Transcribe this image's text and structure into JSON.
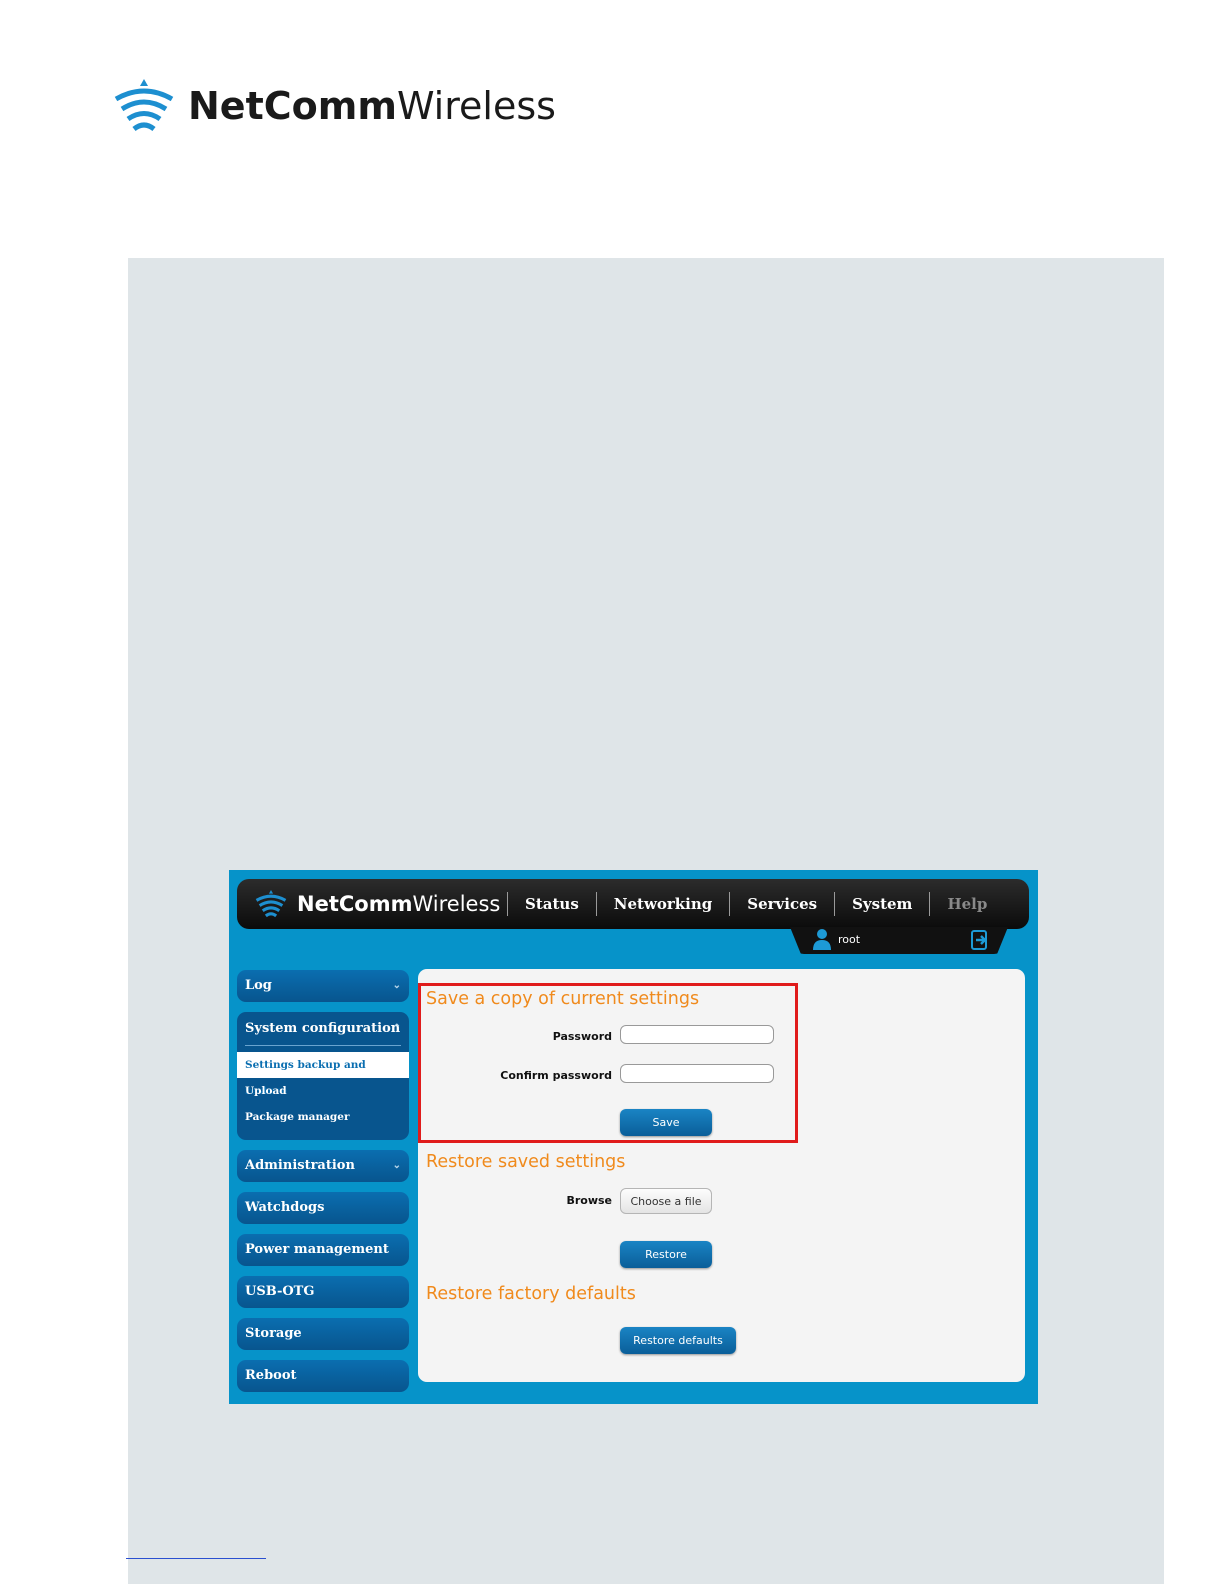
{
  "document": {
    "logo": {
      "brand_bold": "NetComm",
      "brand_light": "Wireless"
    }
  },
  "router_ui": {
    "logo": {
      "brand_bold": "NetComm",
      "brand_light": "Wireless"
    },
    "nav": {
      "status": "Status",
      "networking": "Networking",
      "services": "Services",
      "system": "System",
      "help": "Help"
    },
    "user": {
      "name": "root"
    },
    "sidebar": {
      "log": "Log",
      "system_configuration": "System configuration",
      "sub_items": {
        "settings_backup": "Settings backup and restore",
        "upload": "Upload",
        "package_manager": "Package manager"
      },
      "administration": "Administration",
      "watchdogs": "Watchdogs",
      "power_management": "Power management",
      "usb_otg": "USB-OTG",
      "storage": "Storage",
      "reboot": "Reboot"
    },
    "content": {
      "save_section": {
        "title": "Save a copy of current settings",
        "password_label": "Password",
        "confirm_label": "Confirm password",
        "password_value": "",
        "confirm_value": "",
        "save_button": "Save"
      },
      "restore_section": {
        "title": "Restore saved settings",
        "browse_label": "Browse",
        "choose_file_button": "Choose a file",
        "restore_button": "Restore"
      },
      "factory_section": {
        "title": "Restore factory defaults",
        "restore_defaults_button": "Restore defaults"
      }
    },
    "colors": {
      "frame_blue": "#0693c9",
      "section_title_orange": "#f08a1c",
      "highlight_red": "#e01b1b"
    }
  }
}
